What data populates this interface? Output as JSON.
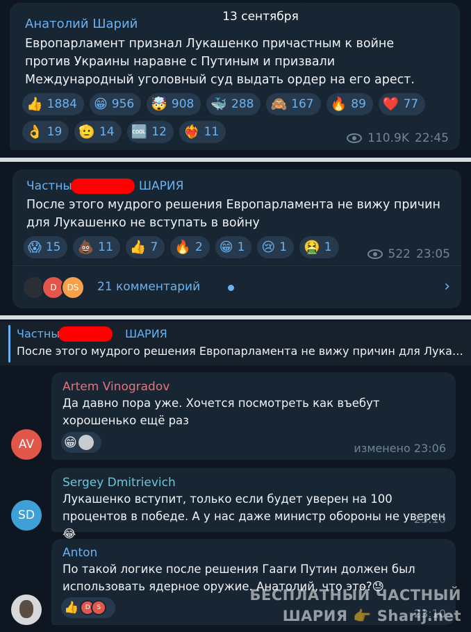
{
  "date_pill": "13 сентября",
  "post1": {
    "sender": "Анатолий Шарий",
    "text": "Европарламент признал Лукашенко причастным к войне против Украины наравне с Путиным и призвали Международный уголовный суд выдать ордер на его арест.",
    "reactions": [
      {
        "emoji": "👍",
        "count": "1884"
      },
      {
        "emoji": "😁",
        "count": "956"
      },
      {
        "emoji": "🤯",
        "count": "908"
      },
      {
        "emoji": "🐳",
        "count": "288"
      },
      {
        "emoji": "🙈",
        "count": "167"
      },
      {
        "emoji": "🔥",
        "count": "89"
      },
      {
        "emoji": "❤️",
        "count": "77"
      },
      {
        "emoji": "👌",
        "count": "19"
      },
      {
        "emoji": "🫡",
        "count": "14"
      },
      {
        "emoji": "🆒",
        "count": "12"
      },
      {
        "emoji": "❤️‍🔥",
        "count": "11"
      }
    ],
    "views": "110.9K",
    "time": "22:45"
  },
  "post2": {
    "sender_left": "Частны",
    "sender_right": "ШАРИЯ",
    "text": "После этого мудрого решения Европарламента не вижу причин для Лукашенко не вступать в войну",
    "reactions": [
      {
        "emoji": "😱",
        "count": "15"
      },
      {
        "emoji": "💩",
        "count": "11"
      },
      {
        "emoji": "👍",
        "count": "7"
      },
      {
        "emoji": "🔥",
        "count": "2"
      },
      {
        "emoji": "😁",
        "count": "1"
      },
      {
        "emoji": "😢",
        "count": "1"
      },
      {
        "emoji": "🤮",
        "count": "1"
      }
    ],
    "views": "522",
    "time": "23:05",
    "comments_label": "21 комментарий",
    "commenter_avatars": [
      "D",
      "DS"
    ]
  },
  "pinned": {
    "title_left": "Частны",
    "title_right": "ШАРИЯ",
    "text": "После этого мудрого решения Европарламента не вижу причин для Лука…"
  },
  "comments": [
    {
      "avatar": "AV",
      "name": "Artem Vinogradov",
      "text": "Да давно пора уже. Хочется посмотреть как въебут хорошенько ещё раз",
      "meta": "изменено 23:06"
    },
    {
      "avatar": "SD",
      "name": "Sergey Dmitrievich",
      "text": "Лукашенко вступит, только если будет уверен на 100 процентов в победе. А у нас даже министр обороны не уверен 😂",
      "meta": "23:10"
    },
    {
      "name": "Anton",
      "text": "По такой логике после решения Гааги Путин должен был использовать ядерное оружие. Анатолий, что это?😓",
      "meta": "23:10",
      "mini_avatars": [
        "D",
        "S"
      ]
    }
  ],
  "watermark": {
    "line1": "БЕСПЛАТНЫЙ ЧАСТНЫЙ",
    "line2": "ШАРИЯ 👉 Sharij.net"
  },
  "colors": {
    "bg": "#0e1621",
    "bubble": "#182533",
    "accent": "#6ab3f3",
    "chip": "#27394d",
    "meta": "#708499",
    "name_blue": "#6ab3f3",
    "name_red": "#e8727a",
    "name_teal": "#6ec5d8"
  }
}
